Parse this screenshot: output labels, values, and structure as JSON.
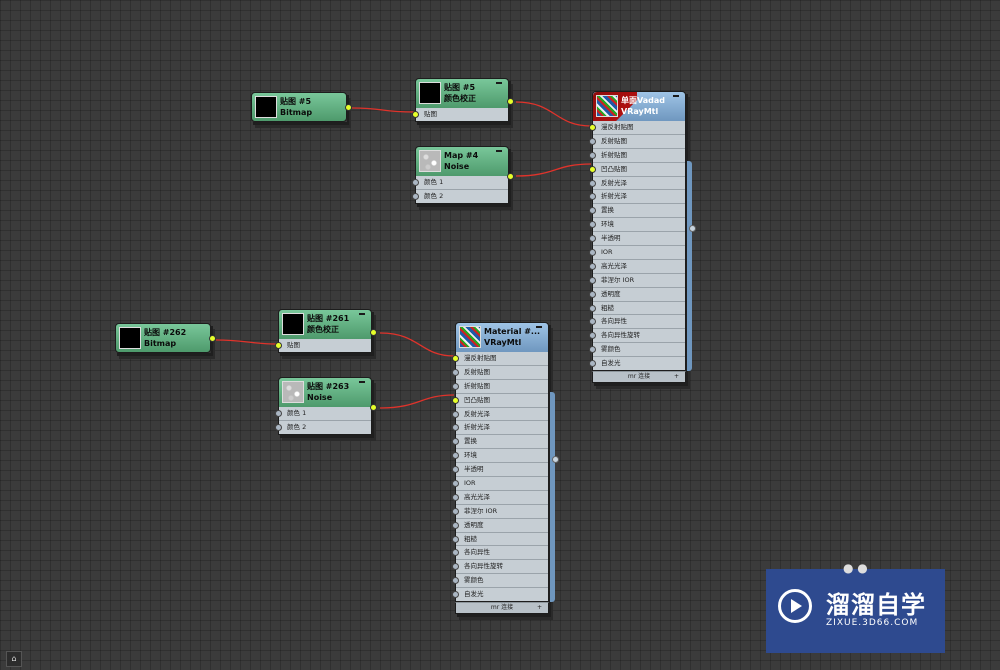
{
  "nodes": {
    "bitmap5": {
      "line1": "贴图 #5",
      "line2": "Bitmap"
    },
    "cc5": {
      "line1": "贴图 #5",
      "line2": "颜色校正",
      "slots": [
        "贴图"
      ]
    },
    "map4": {
      "line1": "Map #4",
      "line2": "Noise",
      "slots": [
        "颜色 1",
        "颜色 2"
      ]
    },
    "mat_top": {
      "line1": "单面Vadad",
      "line2": "VRayMtl",
      "slots": [
        "漫反射贴图",
        "反射贴图",
        "折射贴图",
        "凹凸贴图",
        "反射光泽",
        "折射光泽",
        "置换",
        "环境",
        "半透明",
        "IOR",
        "高光光泽",
        "菲涅尔 IOR",
        "透明度",
        "粗糙",
        "各向异性",
        "各向异性旋转",
        "雾颜色",
        "自发光"
      ],
      "footer": "mr 连接"
    },
    "bitmap262": {
      "line1": "贴图 #262",
      "line2": "Bitmap"
    },
    "cc261": {
      "line1": "贴图 #261",
      "line2": "颜色校正",
      "slots": [
        "贴图"
      ]
    },
    "noise263": {
      "line1": "贴图 #263",
      "line2": "Noise",
      "slots": [
        "颜色 1",
        "颜色 2"
      ]
    },
    "mat_bottom": {
      "line1": "Material #...",
      "line2": "VRayMtl",
      "slots": [
        "漫反射贴图",
        "反射贴图",
        "折射贴图",
        "凹凸贴图",
        "反射光泽",
        "折射光泽",
        "置换",
        "环境",
        "半透明",
        "IOR",
        "高光光泽",
        "菲涅尔 IOR",
        "透明度",
        "粗糙",
        "各向异性",
        "各向异性旋转",
        "雾颜色",
        "自发光"
      ],
      "footer": "mr 连接"
    }
  },
  "watermark": {
    "name": "溜溜自学",
    "url": "ZIXUE.3D66.COM"
  },
  "colors": {
    "wire": "#e0332b",
    "port_active": "#e6ff2a",
    "node_green": "#5fae7e",
    "node_blue": "#7fa6cc"
  }
}
